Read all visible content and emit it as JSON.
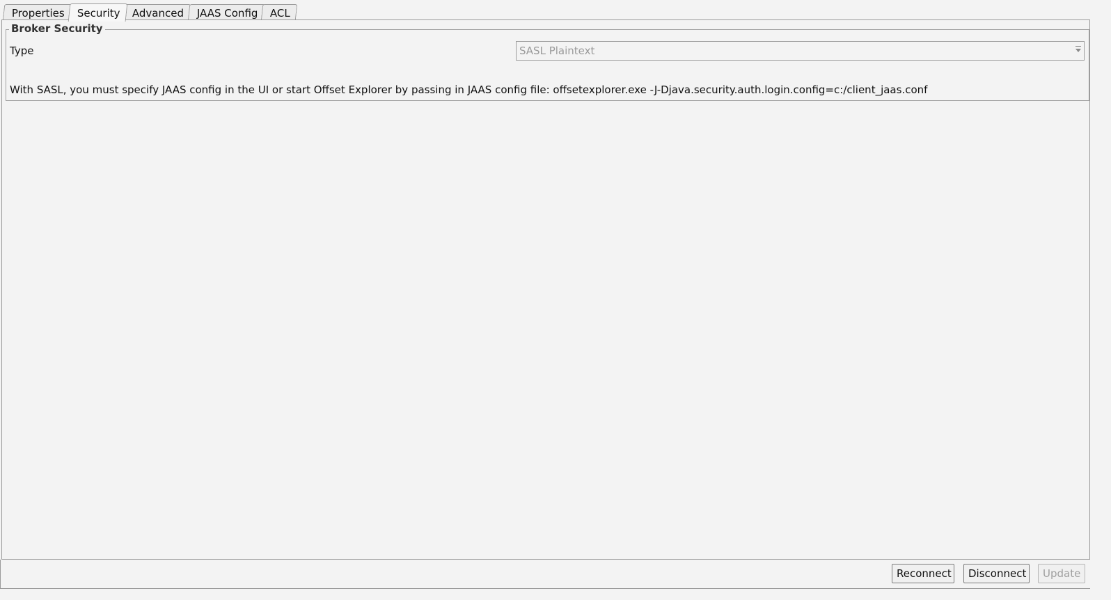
{
  "tabs": [
    {
      "label": "Properties",
      "active": false
    },
    {
      "label": "Security",
      "active": true
    },
    {
      "label": "Advanced",
      "active": false
    },
    {
      "label": "JAAS Config",
      "active": false
    },
    {
      "label": "ACL",
      "active": false
    }
  ],
  "security": {
    "group_title": "Broker Security",
    "type_label": "Type",
    "type_value": "SASL Plaintext",
    "info_text": "With SASL, you must specify JAAS config in the UI or start Offset Explorer by passing in JAAS config file: offsetexplorer.exe -J-Djava.security.auth.login.config=c:/client_jaas.conf"
  },
  "buttons": {
    "reconnect": "Reconnect",
    "disconnect": "Disconnect",
    "update": "Update",
    "update_disabled": true
  },
  "icons": {
    "dropdown": "chevron-down-icon"
  }
}
